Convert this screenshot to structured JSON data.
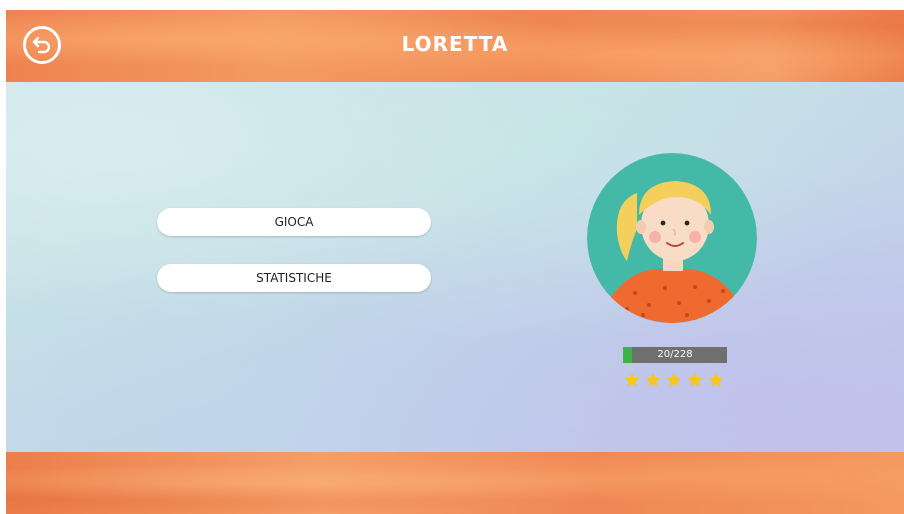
{
  "header": {
    "title": "LORETTA",
    "back_icon": "back-arrow-icon"
  },
  "menu": {
    "play_label": "GIOCA",
    "stats_label": "STATISTICHE"
  },
  "profile": {
    "avatar": "girl-avatar-blonde-ponytail",
    "progress_text": "20/228",
    "progress_fraction": 0.0877,
    "stars_filled": 5,
    "stars_total": 5
  },
  "colors": {
    "bar_orange": "#ef8a55",
    "background_teal": "#c6e0e6",
    "progress_bg": "#6f6f70",
    "progress_fill": "#3db544",
    "star_yellow": "#f7c71b",
    "avatar_bg": "#45b9a8",
    "shirt_orange": "#ef6a2e"
  }
}
